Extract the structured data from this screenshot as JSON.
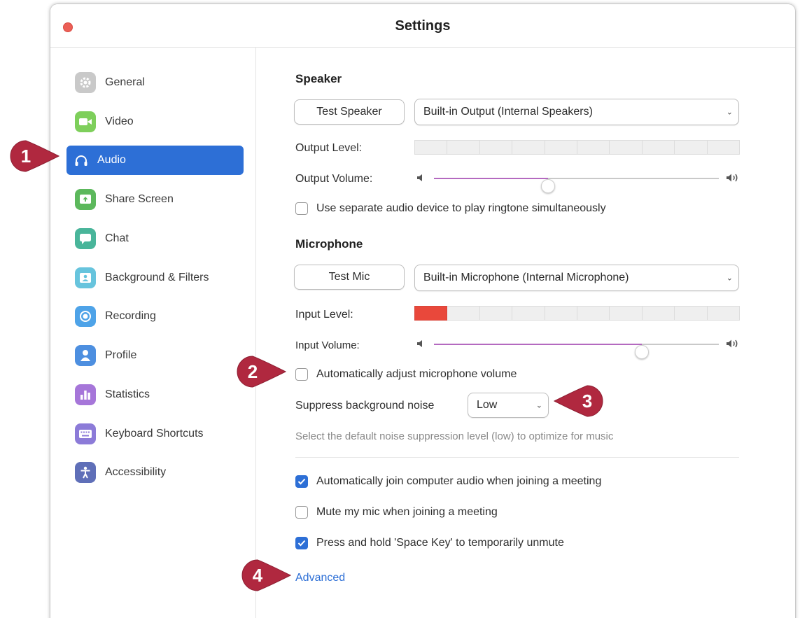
{
  "window": {
    "title": "Settings"
  },
  "sidebar": {
    "items": [
      {
        "label": "General",
        "icon": "gear-icon",
        "color": "#c7c7c7",
        "active": false
      },
      {
        "label": "Video",
        "icon": "video-camera-icon",
        "color": "#7ecf5b",
        "active": false
      },
      {
        "label": "Audio",
        "icon": "headphones-icon",
        "color": "#2d6fd6",
        "active": true
      },
      {
        "label": "Share Screen",
        "icon": "share-screen-icon",
        "color": "#5cb85c",
        "active": false
      },
      {
        "label": "Chat",
        "icon": "chat-bubble-icon",
        "color": "#49b59a",
        "active": false
      },
      {
        "label": "Background & Filters",
        "icon": "background-person-icon",
        "color": "#67c4dd",
        "active": false
      },
      {
        "label": "Recording",
        "icon": "record-icon",
        "color": "#4ea3e8",
        "active": false
      },
      {
        "label": "Profile",
        "icon": "person-icon",
        "color": "#4d8fe0",
        "active": false
      },
      {
        "label": "Statistics",
        "icon": "bar-chart-icon",
        "color": "#a676d9",
        "active": false
      },
      {
        "label": "Keyboard Shortcuts",
        "icon": "keyboard-icon",
        "color": "#8c7bd8",
        "active": false
      },
      {
        "label": "Accessibility",
        "icon": "accessibility-icon",
        "color": "#5f6fb8",
        "active": false
      }
    ]
  },
  "speaker": {
    "section_title": "Speaker",
    "test_button": "Test Speaker",
    "device": "Built-in Output (Internal Speakers)",
    "output_level_label": "Output Level:",
    "output_level_active_segments": 0,
    "meter_segments": 10,
    "output_volume_label": "Output Volume:",
    "output_volume": 0.4,
    "ringtone_checkbox_label": "Use separate audio device to play ringtone simultaneously",
    "ringtone_checked": false
  },
  "microphone": {
    "section_title": "Microphone",
    "test_button": "Test Mic",
    "device": "Built-in Microphone (Internal Microphone)",
    "input_level_label": "Input Level:",
    "input_level_active_segments": 1,
    "meter_segments": 10,
    "input_volume_label": "Input Volume:",
    "input_volume": 0.73,
    "auto_adjust_label": "Automatically adjust microphone volume",
    "auto_adjust_checked": false,
    "suppress_label": "Suppress background noise",
    "suppress_value": "Low",
    "suppress_hint": "Select the default noise suppression level (low) to optimize for music"
  },
  "options": [
    {
      "label": "Automatically join computer audio when joining a meeting",
      "checked": true
    },
    {
      "label": "Mute my mic when joining a meeting",
      "checked": false
    },
    {
      "label": "Press and hold 'Space Key' to temporarily unmute",
      "checked": true
    }
  ],
  "advanced_link": "Advanced",
  "callouts": [
    "1",
    "2",
    "3",
    "4"
  ],
  "colors": {
    "accent": "#2d6fd6",
    "slider": "#b46ac0",
    "level_on": "#e9483b",
    "callout": "#b0283f"
  }
}
